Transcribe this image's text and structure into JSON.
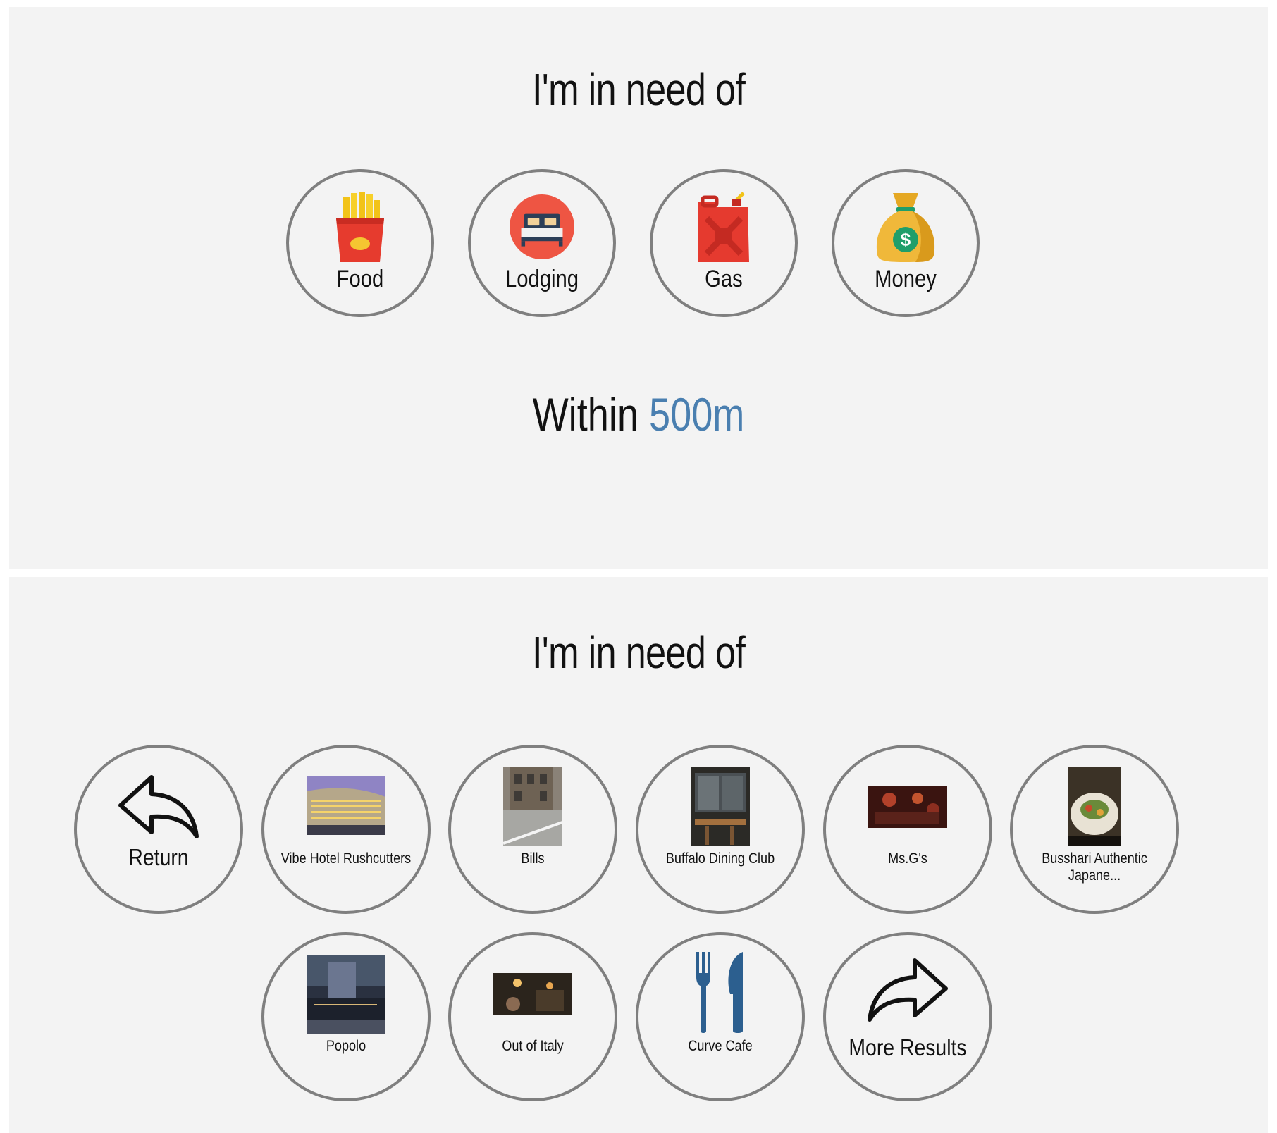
{
  "screen1": {
    "title": "I'm in need of",
    "categories": [
      {
        "label": "Food",
        "icon": "fries-icon"
      },
      {
        "label": "Lodging",
        "icon": "bed-icon"
      },
      {
        "label": "Gas",
        "icon": "gas-can-icon"
      },
      {
        "label": "Money",
        "icon": "money-bag-icon"
      }
    ],
    "within_prefix": "Within",
    "within_distance": "500m"
  },
  "screen2": {
    "title": "I'm in need of",
    "return_label": "Return",
    "more_label": "More Results",
    "results": [
      {
        "name": "Vibe Hotel Rushcutters"
      },
      {
        "name": "Bills"
      },
      {
        "name": "Buffalo Dining Club"
      },
      {
        "name": "Ms.G's"
      },
      {
        "name": "Busshari Authentic Japane..."
      },
      {
        "name": "Popolo"
      },
      {
        "name": "Out of Italy"
      },
      {
        "name": "Curve Cafe"
      }
    ]
  },
  "colors": {
    "panel_bg": "#f3f3f3",
    "circle_border": "#7f7f7f",
    "accent_distance": "#4a7fb0"
  }
}
